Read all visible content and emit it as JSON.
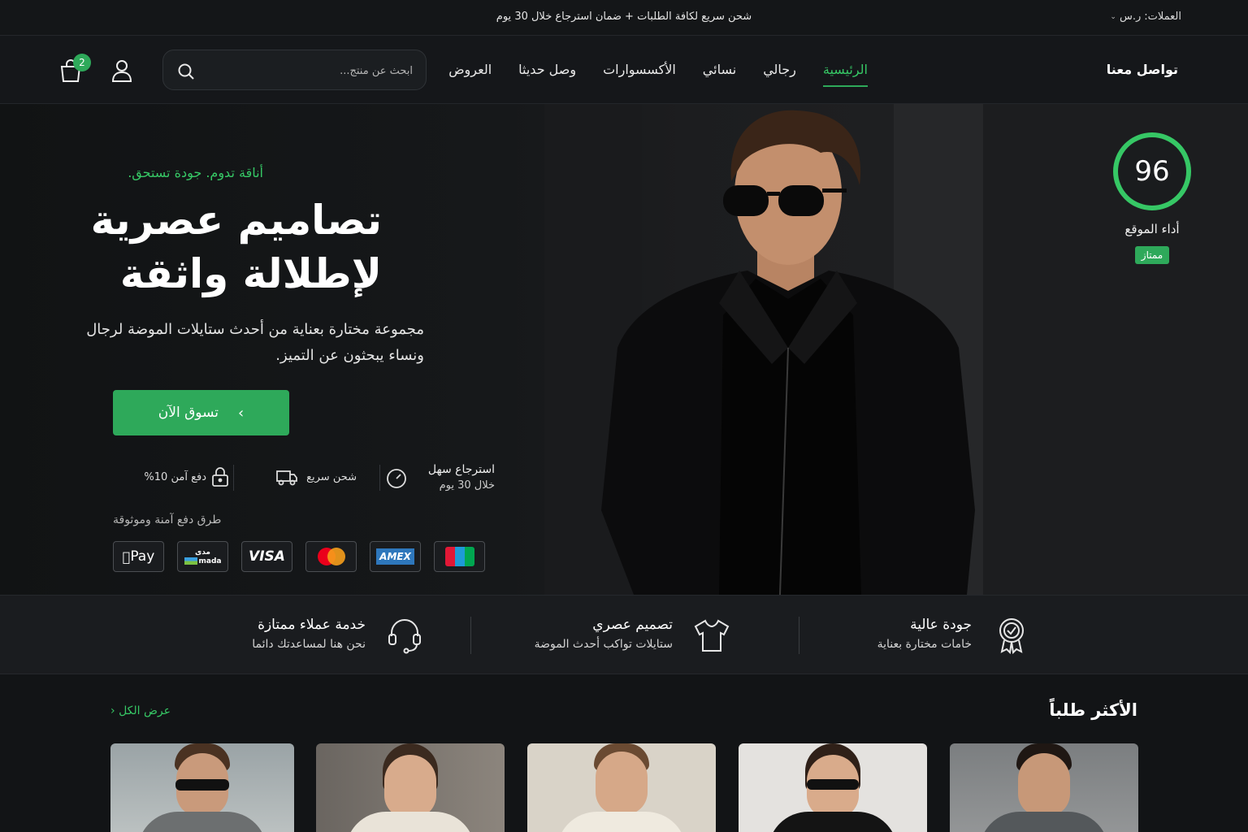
{
  "topbar": {
    "promo": "شحن سريع لكافة الطلبات + ضمان استرجاع خلال 30 يوم",
    "currency_label": "العملات:",
    "currency_value": "ر.س"
  },
  "header": {
    "contact": "تواصل معنا",
    "nav": [
      "الرئيسية",
      "رجالي",
      "نسائي",
      "الأكسسوارات",
      "وصل حديثا",
      "العروض"
    ],
    "active_nav": "الرئيسية",
    "search_placeholder": "ابحث عن منتج...",
    "cart_count": "2"
  },
  "hero": {
    "tagline": "أناقة تدوم. جودة تستحق.",
    "headline": "تصاميم عصرية لإطلالة واثقة",
    "subtext": "مجموعة مختارة بعناية من أحدث ستايلات الموضة لرجال ونساء يبحثون عن التميز.",
    "cta": "تسوق الآن",
    "features": {
      "returns_title": "استرجاع سهل",
      "returns_sub": "خلال 30 يوم",
      "shipping": "شحن سريع",
      "payment": "دفع آمن 10%"
    },
    "payment_label": "طرق دفع آمنة وموثوقة",
    "payment_methods": [
      "Pay",
      "mada",
      "VISA",
      "mastercard",
      "AMEX",
      "JCB"
    ],
    "payment_mada_ar": "مدى"
  },
  "score": {
    "value": "96",
    "label": "أداء الموقع",
    "badge": "ممتاز",
    "color": "#36c765"
  },
  "benefits": [
    {
      "title": "جودة عالية",
      "subtitle": "خامات مختارة بعناية",
      "icon": "badge-icon"
    },
    {
      "title": "تصميم عصري",
      "subtitle": "ستايلات تواكب أحدث الموضة",
      "icon": "tshirt-icon"
    },
    {
      "title": "خدمة عملاء ممتازة",
      "subtitle": "نحن هنا لمساعدتك دائما",
      "icon": "headset-icon"
    }
  ],
  "best_sellers": {
    "title": "الأكثر طلباً",
    "view_all": "عرض الكل"
  },
  "colors": {
    "accent": "#2ea95a",
    "accent_text": "#36c765",
    "background": "#121416"
  }
}
